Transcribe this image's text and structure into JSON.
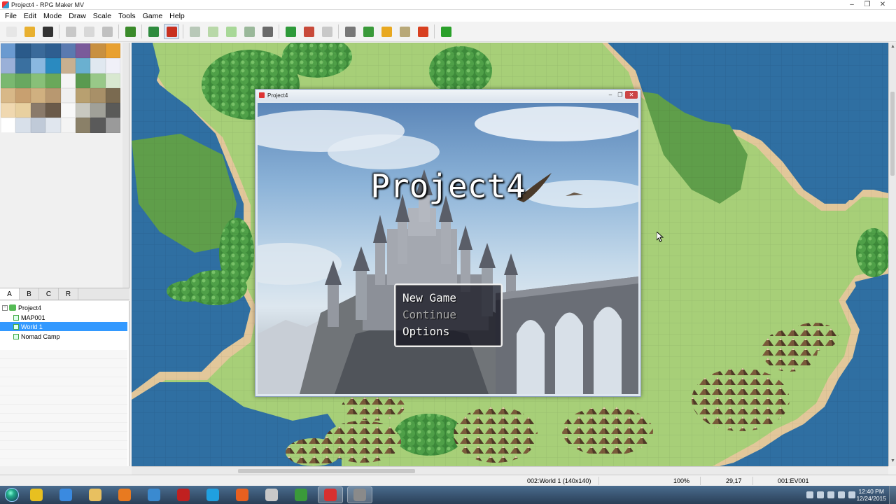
{
  "window": {
    "title": "Project4 - RPG Maker MV",
    "controls": [
      "–",
      "❐",
      "✕"
    ]
  },
  "menu": [
    "File",
    "Edit",
    "Mode",
    "Draw",
    "Scale",
    "Tools",
    "Game",
    "Help"
  ],
  "toolbar": [
    {
      "icon": "new-project-icon",
      "color": "#e6e6e6"
    },
    {
      "icon": "open-folder-icon",
      "color": "#e8b030"
    },
    {
      "icon": "save-icon",
      "color": "#333333"
    },
    {
      "icon": "cut-icon",
      "color": "#c8c8c8"
    },
    {
      "icon": "copy-icon",
      "color": "#d8d8d8"
    },
    {
      "icon": "paste-icon",
      "color": "#c0c0c0"
    },
    {
      "icon": "undo-icon",
      "color": "#3a8a2a"
    },
    {
      "icon": "map-mode-icon",
      "color": "#2e8b3e"
    },
    {
      "icon": "event-mode-icon",
      "color": "#c83020"
    },
    {
      "icon": "pencil-icon",
      "color": "#b8c8b8"
    },
    {
      "icon": "rectangle-icon",
      "color": "#b8d8a8"
    },
    {
      "icon": "ellipse-icon",
      "color": "#a8d898"
    },
    {
      "icon": "fill-icon",
      "color": "#9ab89a"
    },
    {
      "icon": "shadow-pen-icon",
      "color": "#6a6a6a"
    },
    {
      "icon": "zoom-in-icon",
      "color": "#2e9a3a"
    },
    {
      "icon": "zoom-out-icon",
      "color": "#c84a3a"
    },
    {
      "icon": "actual-size-icon",
      "color": "#c8c8c8"
    },
    {
      "icon": "database-icon",
      "color": "#777777"
    },
    {
      "icon": "plugin-manager-icon",
      "color": "#3a9a3a"
    },
    {
      "icon": "sound-test-icon",
      "color": "#e8a820"
    },
    {
      "icon": "event-searcher-icon",
      "color": "#b8a878"
    },
    {
      "icon": "character-generator-icon",
      "color": "#d84020"
    },
    {
      "icon": "playtest-icon",
      "color": "#2aa02a"
    }
  ],
  "tile_palette": {
    "colors": [
      "#6a9ad0",
      "#2a5a8a",
      "#3a6a9a",
      "#2e5e90",
      "#5a7ab0",
      "#7a5a9a",
      "#c89040",
      "#e8a030",
      "#9ab0d8",
      "#3a70a0",
      "#8ab8e0",
      "#2a8ac0",
      "#c8b090",
      "#6ab0d0",
      "#e0e8f0",
      "#f0f0f8",
      "#7ab870",
      "#68a860",
      "#88c078",
      "#6aa85a",
      "#f4f4f4",
      "#5a9a50",
      "#98c888",
      "#d8e8d0",
      "#d8b888",
      "#c8a070",
      "#d0b080",
      "#b89870",
      "#f0f0f0",
      "#b8a070",
      "#a89068",
      "#7a6a50",
      "#f0d8b0",
      "#e8d0a0",
      "#8a7a6a",
      "#6a5a4a",
      "#f8f8f8",
      "#c8c8c0",
      "#a0a098",
      "#5a5a58",
      "#ffffff",
      "#d8e0ea",
      "#c0cad8",
      "#e0e6ee",
      "#f4f4f4",
      "#8a8068",
      "#5a5a5a",
      "#9a9a9a"
    ]
  },
  "layer_tabs": [
    "A",
    "B",
    "C",
    "R"
  ],
  "map_tree": [
    {
      "label": "Project4",
      "type": "project",
      "selected": false
    },
    {
      "label": "MAP001",
      "type": "map",
      "selected": false
    },
    {
      "label": "World 1",
      "type": "map",
      "selected": true
    },
    {
      "label": "Nomad Camp",
      "type": "map",
      "selected": false
    }
  ],
  "game_window": {
    "title": "Project4",
    "game_title": "Project4",
    "menu_items": [
      {
        "label": "New Game",
        "state": "selected"
      },
      {
        "label": "Continue",
        "state": "disabled"
      },
      {
        "label": "Options",
        "state": "normal"
      }
    ]
  },
  "status": {
    "map": "002:World 1 (140x140)",
    "zoom": "100%",
    "coords": "29,17",
    "event": "001:EV001"
  },
  "taskbar": {
    "apps": [
      {
        "icon": "chrome-icon",
        "color": "#e8c020"
      },
      {
        "icon": "internet-explorer-icon",
        "color": "#3a8ae0"
      },
      {
        "icon": "file-explorer-icon",
        "color": "#e8c060"
      },
      {
        "icon": "media-player-icon",
        "color": "#e87a20"
      },
      {
        "icon": "ccleaner-icon",
        "color": "#3a8ad0"
      },
      {
        "icon": "record-icon",
        "color": "#c02020"
      },
      {
        "icon": "skype-icon",
        "color": "#20a0e0"
      },
      {
        "icon": "firefox-icon",
        "color": "#e86020"
      },
      {
        "icon": "app-icon",
        "color": "#c8c8c8"
      },
      {
        "icon": "camtasia-icon",
        "color": "#3a9a3a"
      },
      {
        "icon": "rpg-maker-icon",
        "color": "#d83030"
      },
      {
        "icon": "game-icon",
        "color": "#8a8a8a"
      }
    ],
    "time": "12:40 PM",
    "date": "12/24/2015"
  }
}
